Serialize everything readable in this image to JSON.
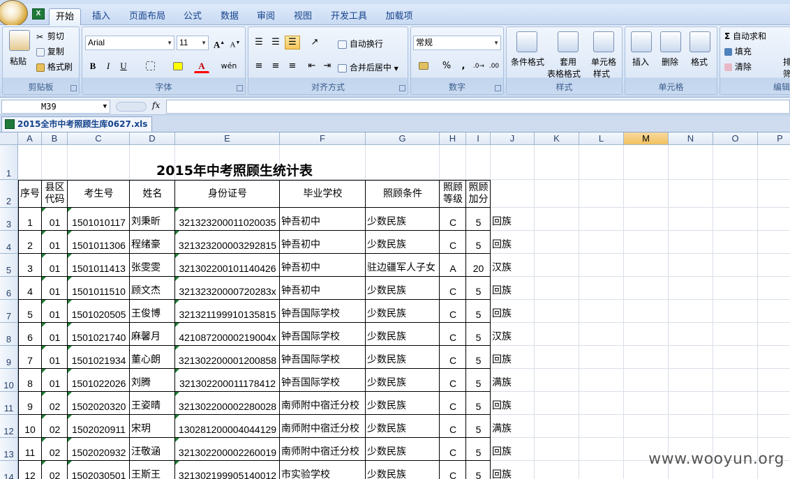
{
  "ribbon": {
    "tabs": [
      "开始",
      "插入",
      "页面布局",
      "公式",
      "数据",
      "审阅",
      "视图",
      "开发工具",
      "加载项"
    ],
    "clipboard": {
      "paste": "粘贴",
      "cut": "剪切",
      "copy": "复制",
      "format_painter": "格式刷",
      "label": "剪贴板"
    },
    "font": {
      "name": "Arial",
      "size": "11",
      "label": "字体"
    },
    "alignment": {
      "wrap": "自动换行",
      "merge": "合并后居中",
      "label": "对齐方式"
    },
    "number": {
      "format": "常规",
      "label": "数字"
    },
    "styles": {
      "conditional": "条件格式",
      "table1": "套用",
      "table2": "表格格式",
      "cell1": "单元格",
      "cell2": "样式",
      "label": "样式"
    },
    "cells": {
      "insert": "插入",
      "delete": "删除",
      "format": "格式",
      "label": "单元格"
    },
    "editing": {
      "autosum": "自动求和",
      "fill": "填充",
      "clear": "清除",
      "sort_partial": "排",
      "filter_partial": "筛",
      "label": "编辑"
    }
  },
  "formula_bar": {
    "name_box": "M39",
    "fx": "fx",
    "value": ""
  },
  "workbook_tab": "2015全市中考照顾生库0627.xls",
  "sheet": {
    "columns": [
      "A",
      "B",
      "C",
      "D",
      "E",
      "F",
      "G",
      "H",
      "I",
      "J",
      "K",
      "L",
      "M",
      "N",
      "O",
      "P"
    ],
    "active_column": "M",
    "row_numbers": [
      "1",
      "2",
      "3",
      "4",
      "5",
      "6",
      "7",
      "8",
      "9",
      "10",
      "11",
      "12",
      "13",
      "14"
    ],
    "title": "2015年中考照顾生统计表",
    "headers": [
      "序号",
      "县区代码",
      "考生号",
      "姓名",
      "身份证号",
      "毕业学校",
      "照顾条件",
      "照顾等级",
      "照顾加分"
    ],
    "header_lines": {
      "b": [
        "县区",
        "代码"
      ],
      "h": [
        "照顾",
        "等级"
      ],
      "i": [
        "照顾",
        "加分"
      ]
    },
    "rows": [
      [
        "1",
        "01",
        "1501010117",
        "刘秉昕",
        "321323200011020035",
        "钟吾初中",
        "少数民族",
        "C",
        "5",
        "回族"
      ],
      [
        "2",
        "01",
        "1501011306",
        "程绪豪",
        "321323200003292815",
        "钟吾初中",
        "少数民族",
        "C",
        "5",
        "回族"
      ],
      [
        "3",
        "01",
        "1501011413",
        "张雯雯",
        "321302200101140426",
        "钟吾初中",
        "驻边疆军人子女",
        "A",
        "20",
        "汉族"
      ],
      [
        "4",
        "01",
        "1501011510",
        "顾文杰",
        "32132320000720283x",
        "钟吾初中",
        "少数民族",
        "C",
        "5",
        "回族"
      ],
      [
        "5",
        "01",
        "1501020505",
        "王俊博",
        "321321199910135815",
        "钟吾国际学校",
        "少数民族",
        "C",
        "5",
        "回族"
      ],
      [
        "6",
        "01",
        "1501021740",
        "麻馨月",
        "42108720000219004x",
        "钟吾国际学校",
        "少数民族",
        "C",
        "5",
        "汉族"
      ],
      [
        "7",
        "01",
        "1501021934",
        "董心朗",
        "321302200001200858",
        "钟吾国际学校",
        "少数民族",
        "C",
        "5",
        "回族"
      ],
      [
        "8",
        "01",
        "1501022026",
        "刘腾",
        "321302200011178412",
        "钟吾国际学校",
        "少数民族",
        "C",
        "5",
        "满族"
      ],
      [
        "9",
        "02",
        "1502020320",
        "王姿晴",
        "321302200002280028",
        "南师附中宿迁分校",
        "少数民族",
        "C",
        "5",
        "回族"
      ],
      [
        "10",
        "02",
        "1502020911",
        "宋玥",
        "130281200004044129",
        "南师附中宿迁分校",
        "少数民族",
        "C",
        "5",
        "满族"
      ],
      [
        "11",
        "02",
        "1502020932",
        "汪敬涵",
        "321302200002260019",
        "南师附中宿迁分校",
        "少数民族",
        "C",
        "5",
        "回族"
      ],
      [
        "12",
        "02",
        "1502030501",
        "王斯王",
        "321302199905140012",
        "市实验学校",
        "少数民族",
        "C",
        "5",
        "回族"
      ]
    ]
  },
  "watermark": "www.wooyun.org"
}
